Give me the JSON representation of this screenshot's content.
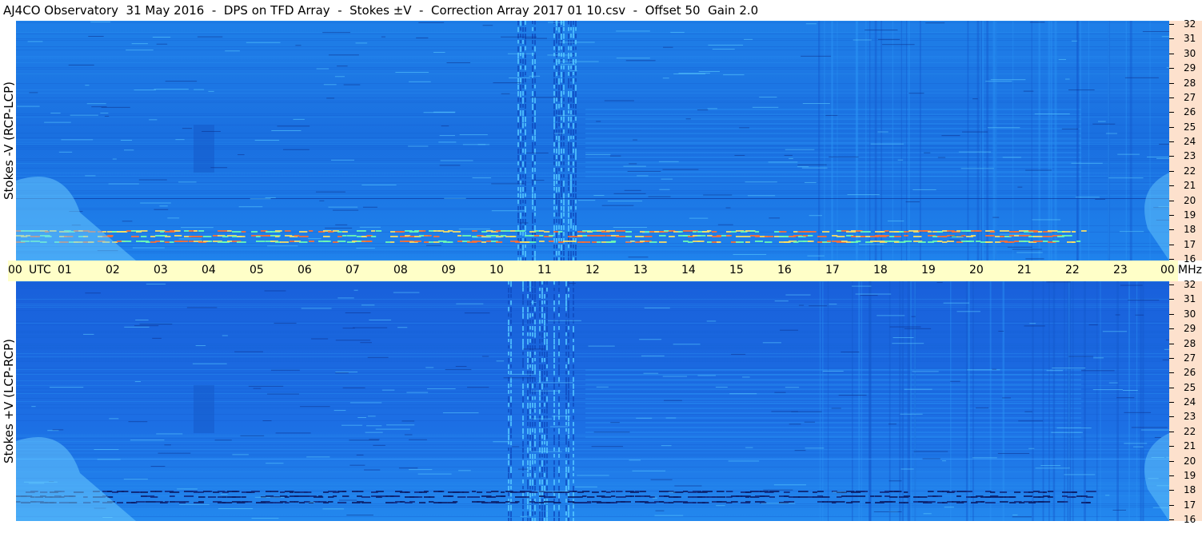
{
  "title": "AJ4CO Observatory  31 May 2016  -  DPS on TFD Array  -  Stokes ±V  -  Correction Array 2017 01 10.csv  -  Offset 50  Gain 2.0",
  "chart_data": {
    "type": "heatmap",
    "panels": [
      {
        "ylabel": "Stokes -V (RCP-LCP)"
      },
      {
        "ylabel": "Stokes +V (LCP-RCP)"
      }
    ],
    "x_ticks": [
      "00",
      "UTC",
      "01",
      "02",
      "03",
      "04",
      "05",
      "06",
      "07",
      "08",
      "09",
      "10",
      "11",
      "12",
      "13",
      "14",
      "15",
      "16",
      "17",
      "18",
      "19",
      "20",
      "21",
      "22",
      "23",
      "00",
      "MHz"
    ],
    "x_range_hours": [
      0,
      24
    ],
    "y_ticks": [
      "16",
      "17",
      "18",
      "19",
      "20",
      "21",
      "22",
      "23",
      "24",
      "25",
      "26",
      "27",
      "28",
      "29",
      "30",
      "31",
      "32"
    ],
    "y_range_mhz": [
      16,
      32
    ],
    "colors": {
      "background": "#1a6fe0",
      "time_axis": "#ffffc8",
      "freq_axis": "#fde1cd"
    }
  }
}
